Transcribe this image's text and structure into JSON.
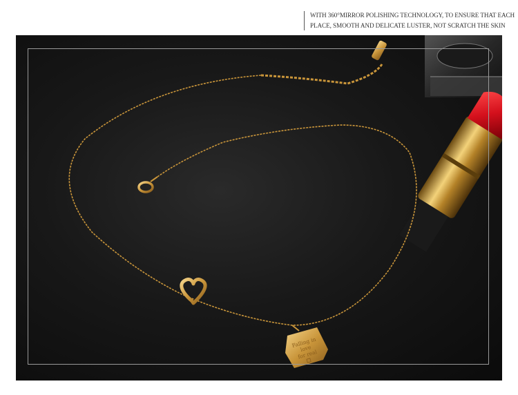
{
  "caption": {
    "line1": "WITH 360°MIRROR POLISHING TECHNOLOGY, TO ENSURE THAT EACH",
    "line2": "PLACE, SMOOTH AND DELICATE LUSTER, NOT SCRATCH THE SKIN"
  },
  "pendant": {
    "engraving_line1": "Falling in",
    "engraving_line2": "love",
    "engraving_line3": "for real"
  },
  "colors": {
    "background": "#111111",
    "gold": "#c9953a",
    "gold_light": "#f0c877",
    "lipstick_red": "#d4101c"
  }
}
